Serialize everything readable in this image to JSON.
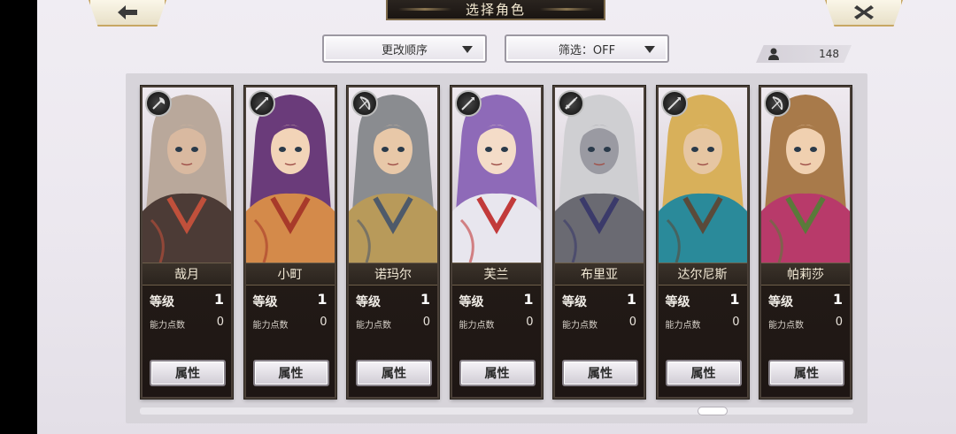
{
  "header": {
    "title": "选择角色",
    "back_icon": "arrow-left-icon",
    "close_icon": "close-x-icon"
  },
  "controls": {
    "order_label": "更改顺序",
    "filter_label": "筛选：OFF",
    "character_count": "148"
  },
  "cards": [
    {
      "name": "哉月",
      "level_label": "等级",
      "level": "1",
      "points_label": "能力点数",
      "points": "0",
      "attr_label": "属性",
      "weapon": "axe-icon",
      "palette": [
        "#b9a89b",
        "#4c3b36",
        "#c0503b",
        "#d9b9a0"
      ]
    },
    {
      "name": "小町",
      "level_label": "等级",
      "level": "1",
      "points_label": "能力点数",
      "points": "0",
      "attr_label": "属性",
      "weapon": "spear-icon",
      "palette": [
        "#6a3b7a",
        "#d48a4a",
        "#a83a2a",
        "#f2d4b8"
      ]
    },
    {
      "name": "诺玛尔",
      "level_label": "等级",
      "level": "1",
      "points_label": "能力点数",
      "points": "0",
      "attr_label": "属性",
      "weapon": "bow-icon",
      "palette": [
        "#8a8c90",
        "#b89a5a",
        "#4e5a6a",
        "#e8c8a8"
      ]
    },
    {
      "name": "芙兰",
      "level_label": "等级",
      "level": "1",
      "points_label": "能力点数",
      "points": "0",
      "attr_label": "属性",
      "weapon": "spear-icon",
      "palette": [
        "#8e6ab8",
        "#e8e6ee",
        "#c23a3a",
        "#f4dcc8"
      ]
    },
    {
      "name": "布里亚",
      "level_label": "等级",
      "level": "1",
      "points_label": "能力点数",
      "points": "0",
      "attr_label": "属性",
      "weapon": "sword-icon",
      "palette": [
        "#cfcfd2",
        "#6a6a72",
        "#3b3a6a",
        "#9a9aa2"
      ]
    },
    {
      "name": "达尔尼斯",
      "level_label": "等级",
      "level": "1",
      "points_label": "能力点数",
      "points": "0",
      "attr_label": "属性",
      "weapon": "spear-icon",
      "palette": [
        "#d8b05a",
        "#2a8a9a",
        "#5a4a3a",
        "#e6c6a2"
      ]
    },
    {
      "name": "帕莉莎",
      "level_label": "等级",
      "level": "1",
      "points_label": "能力点数",
      "points": "0",
      "attr_label": "属性",
      "weapon": "bow-icon",
      "palette": [
        "#a87a4a",
        "#b83a6a",
        "#5a7a3a",
        "#f0d0b0"
      ]
    }
  ]
}
